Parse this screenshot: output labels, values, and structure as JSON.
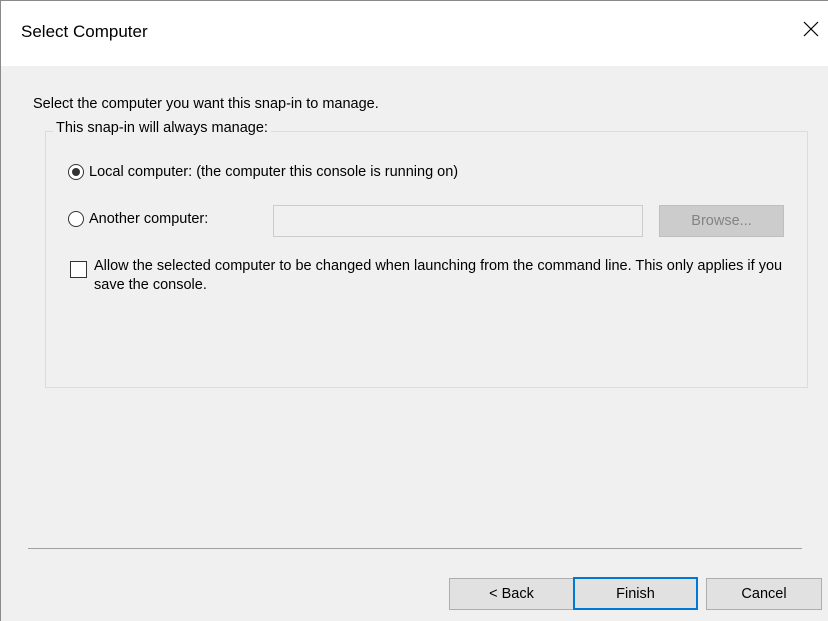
{
  "window": {
    "title": "Select Computer",
    "close_glyph": "close-icon"
  },
  "instruction": "Select the computer you want this snap-in to manage.",
  "group": {
    "legend": "This snap-in will always manage:",
    "local": {
      "label": "Local computer:  (the computer this console is running on)",
      "selected": true
    },
    "another": {
      "label": "Another computer:",
      "selected": false,
      "value": "",
      "placeholder": ""
    },
    "browse_label": "Browse...",
    "allow_change": {
      "label": "Allow the selected computer to be changed when launching from the command line.  This only applies if you save the console.",
      "checked": false
    }
  },
  "footer": {
    "back_label": "< Back",
    "finish_label": "Finish",
    "cancel_label": "Cancel"
  },
  "colors": {
    "accent": "#0078d7",
    "dialog_bg": "#f0f0f0",
    "disabled_text": "#838383"
  }
}
